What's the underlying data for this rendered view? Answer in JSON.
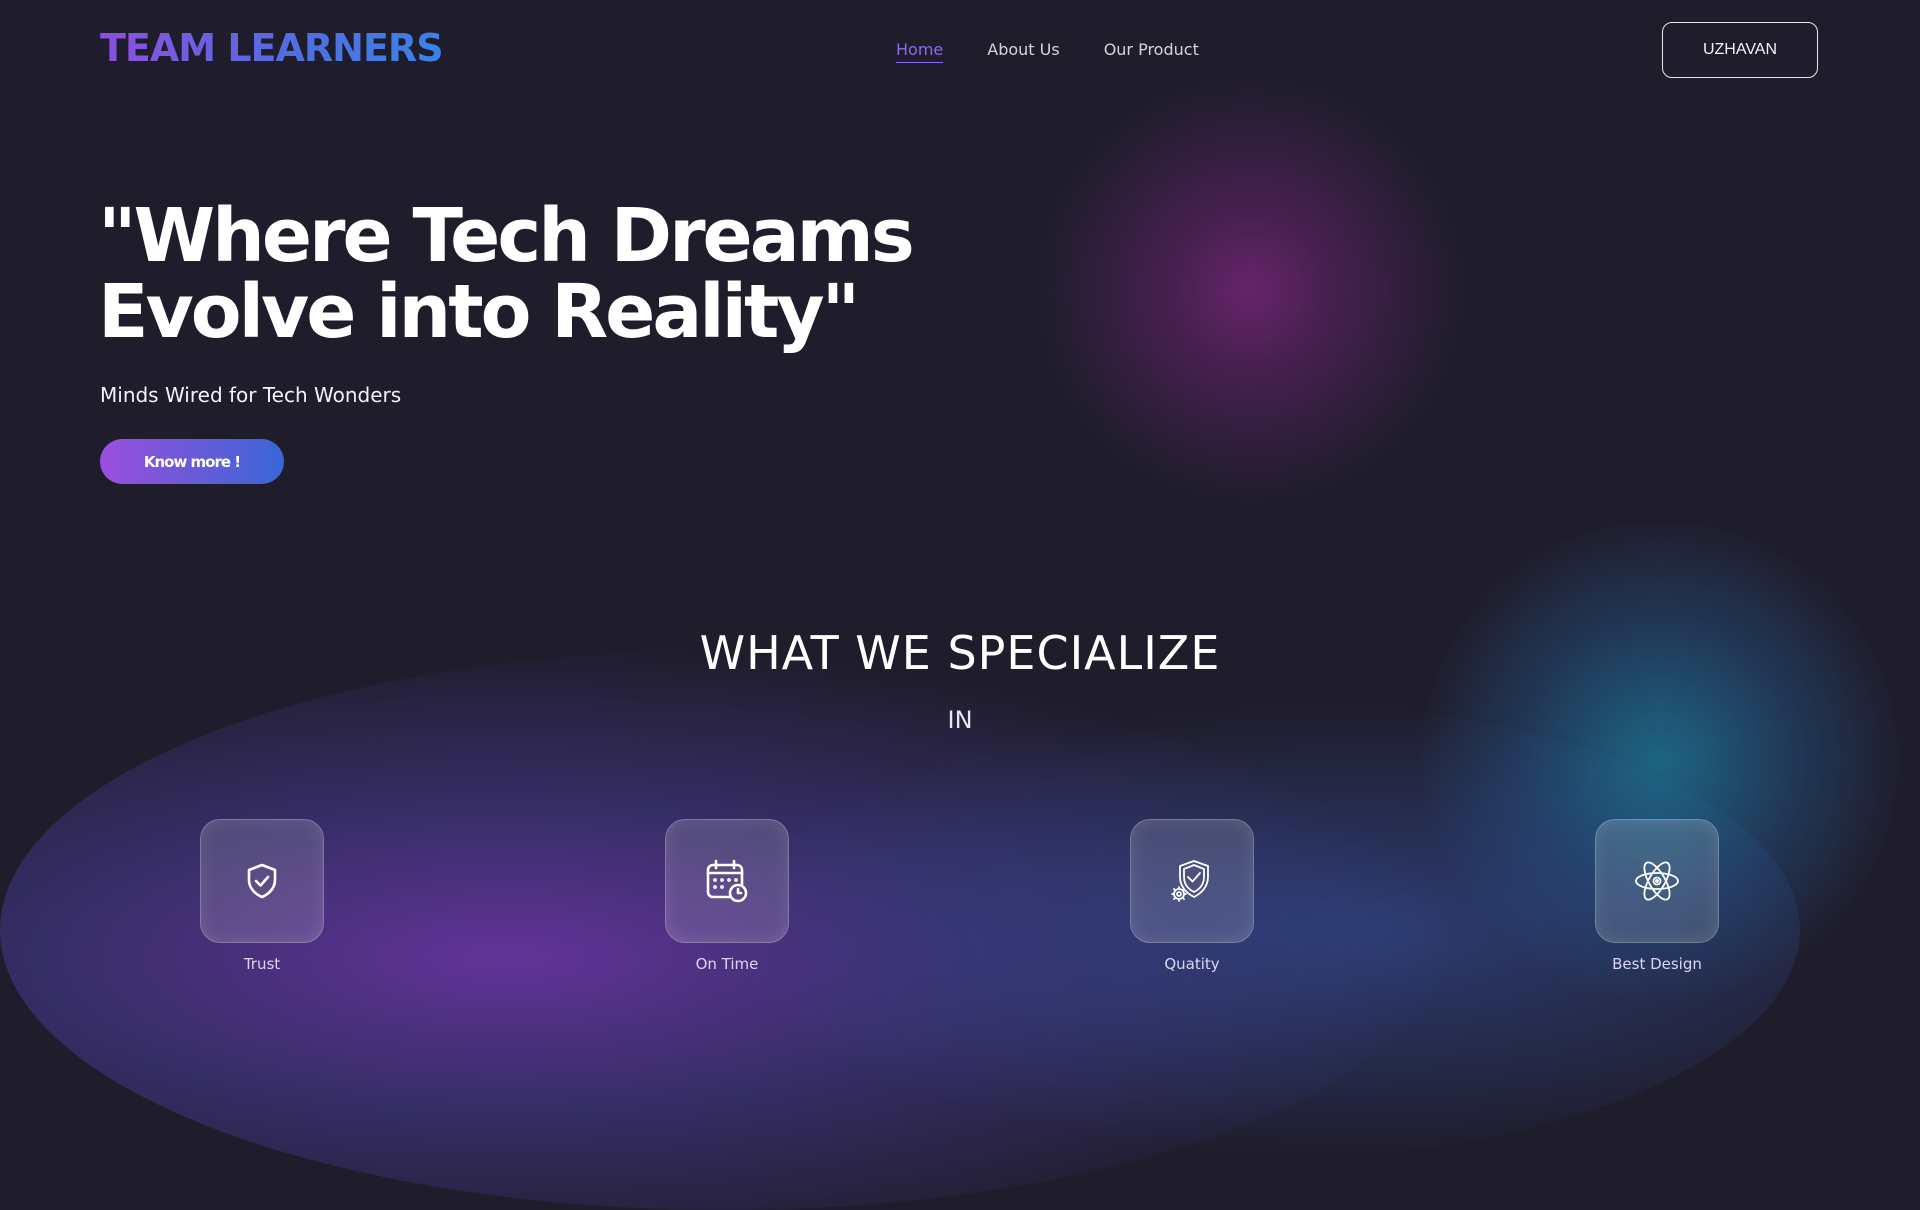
{
  "brand": {
    "logo_text": "TEAM LEARNERS"
  },
  "nav": {
    "items": [
      {
        "label": "Home",
        "active": true
      },
      {
        "label": "About Us",
        "active": false
      },
      {
        "label": "Our Product",
        "active": false
      }
    ]
  },
  "user": {
    "button_label": "UZHAVAN"
  },
  "hero": {
    "title_line1": "\"Where Tech Dreams",
    "title_line2": "Evolve into Reality\"",
    "subtitle": "Minds Wired for Tech Wonders",
    "cta_label": "Know more !"
  },
  "specialize": {
    "title": "WHAT WE SPECIALIZE",
    "subtitle": "IN",
    "features": [
      {
        "label": "Trust",
        "icon": "shield-check-icon"
      },
      {
        "label": "On Time",
        "icon": "calendar-clock-icon"
      },
      {
        "label": "Quatity",
        "icon": "quality-shield-gear-icon"
      },
      {
        "label": "Best Design",
        "icon": "atom-icon"
      }
    ]
  },
  "colors": {
    "background": "#1f1d2c",
    "accent_purple": "#9b4fdc",
    "accent_blue": "#3966d6",
    "nav_active": "#8a6bf0"
  }
}
